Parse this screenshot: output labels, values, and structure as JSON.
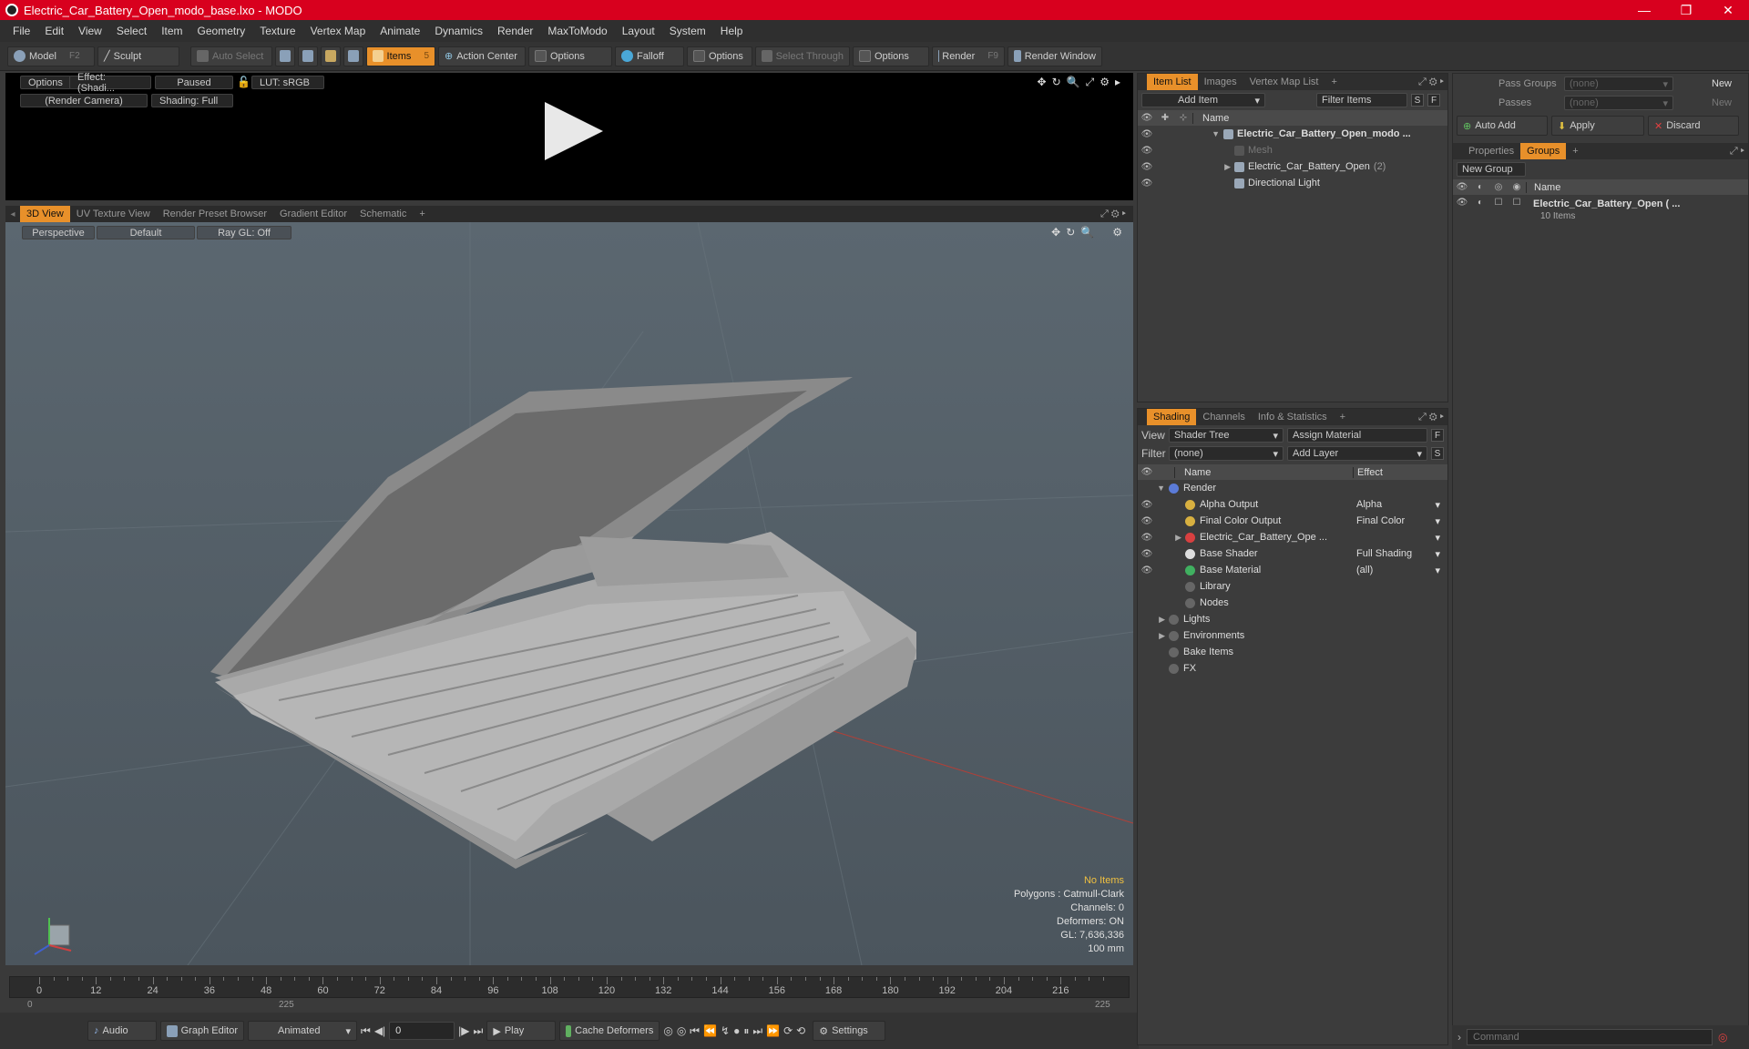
{
  "window": {
    "title": "Electric_Car_Battery_Open_modo_base.lxo - MODO",
    "min": "—",
    "max": "❐",
    "close": "✕"
  },
  "menu": [
    "File",
    "Edit",
    "View",
    "Select",
    "Item",
    "Geometry",
    "Texture",
    "Vertex Map",
    "Animate",
    "Dynamics",
    "Render",
    "MaxToModo",
    "Layout",
    "System",
    "Help"
  ],
  "toolbar": {
    "model": "Model",
    "model_key": "F2",
    "sculpt": "Sculpt",
    "auto_select": "Auto Select",
    "items": "Items",
    "items_key": "5",
    "action_center": "Action Center",
    "options1": "Options",
    "falloff": "Falloff",
    "options2": "Options",
    "select_through": "Select Through",
    "options3": "Options",
    "render": "Render",
    "render_key": "F9",
    "render_window": "Render Window"
  },
  "preview": {
    "options": "Options",
    "effect": "Effect: (Shadi...",
    "paused": "Paused",
    "lut": "LUT: sRGB",
    "camera": "(Render Camera)",
    "shading": "Shading: Full"
  },
  "viewtabs": [
    "3D View",
    "UV Texture View",
    "Render Preset Browser",
    "Gradient Editor",
    "Schematic",
    "+"
  ],
  "viewport": {
    "perspective": "Perspective",
    "default": "Default",
    "raygl": "Ray GL: Off"
  },
  "hud": {
    "items": "No Items",
    "polygons": "Polygons : Catmull-Clark",
    "channels": "Channels: 0",
    "deformers": "Deformers: ON",
    "gl": "GL: 7,636,336",
    "scale": "100 mm"
  },
  "timeline": {
    "labels": [
      "0",
      "12",
      "24",
      "36",
      "48",
      "60",
      "72",
      "84",
      "96",
      "108",
      "120",
      "132",
      "144",
      "156",
      "168",
      "180",
      "192",
      "204",
      "216"
    ],
    "start": "0",
    "end_a": "225",
    "end_b": "225"
  },
  "bottom": {
    "audio": "Audio",
    "graph_editor": "Graph Editor",
    "animated": "Animated",
    "frame": "0",
    "play": "Play",
    "cache": "Cache Deformers",
    "settings": "Settings"
  },
  "itemlist": {
    "tabs": [
      "Item List",
      "Images",
      "Vertex Map List",
      "+"
    ],
    "add_item": "Add Item",
    "filter": "Filter Items",
    "s": "S",
    "f": "F",
    "col_name": "Name",
    "rows": [
      {
        "label": "Electric_Car_Battery_Open_modo ...",
        "bold": true,
        "indent": 0,
        "arrow": "▼"
      },
      {
        "label": "Mesh",
        "dim": true,
        "indent": 1,
        "arrow": ""
      },
      {
        "label": "Electric_Car_Battery_Open",
        "count": "(2)",
        "indent": 1,
        "arrow": "▶"
      },
      {
        "label": "Directional Light",
        "indent": 1,
        "arrow": ""
      }
    ]
  },
  "shading": {
    "tabs": [
      "Shading",
      "Channels",
      "Info & Statistics",
      "+"
    ],
    "view_label": "View",
    "view_value": "Shader Tree",
    "assign": "Assign Material",
    "f": "F",
    "filter_label": "Filter",
    "filter_value": "(none)",
    "add_layer": "Add Layer",
    "s": "S",
    "col_name": "Name",
    "col_effect": "Effect",
    "rows": [
      {
        "label": "Render",
        "effect": "",
        "indent": 0,
        "arrow": "▼",
        "eye": false,
        "color": "#5b7bd8"
      },
      {
        "label": "Alpha Output",
        "effect": "Alpha",
        "indent": 1,
        "eye": true,
        "color": "#d8b040"
      },
      {
        "label": "Final Color Output",
        "effect": "Final Color",
        "indent": 1,
        "eye": true,
        "color": "#d8b040"
      },
      {
        "label": "Electric_Car_Battery_Ope ...",
        "effect": "",
        "indent": 1,
        "arrow": "▶",
        "eye": true,
        "color": "#d84040"
      },
      {
        "label": "Base Shader",
        "effect": "Full Shading",
        "indent": 1,
        "eye": true,
        "color": "#dddddd"
      },
      {
        "label": "Base Material",
        "effect": "(all)",
        "indent": 1,
        "eye": true,
        "color": "#40b060"
      },
      {
        "label": "Library",
        "indent": 1,
        "arrow": "",
        "eye": false,
        "color": ""
      },
      {
        "label": "Nodes",
        "indent": 1,
        "eye": false,
        "color": ""
      },
      {
        "label": "Lights",
        "indent": 0,
        "arrow": "▶",
        "eye": false,
        "color": ""
      },
      {
        "label": "Environments",
        "indent": 0,
        "arrow": "▶",
        "eye": false,
        "color": ""
      },
      {
        "label": "Bake Items",
        "indent": 0,
        "eye": false,
        "color": ""
      },
      {
        "label": "FX",
        "indent": 0,
        "eye": false,
        "color": ""
      }
    ]
  },
  "groups": {
    "pass_groups": "Pass Groups",
    "pass_groups_value": "(none)",
    "new1": "New",
    "passes": "Passes",
    "passes_value": "(none)",
    "new2": "New",
    "auto_add": "Auto Add",
    "apply": "Apply",
    "discard": "Discard",
    "tabs": [
      "Properties",
      "Groups",
      "+"
    ],
    "new_group": "New Group",
    "col_name": "Name",
    "group_name": "Electric_Car_Battery_Open ( ...",
    "group_items": "10 Items"
  },
  "command": {
    "placeholder": "Command"
  },
  "colors": {
    "accent": "#e8902a",
    "title": "#d8001e"
  }
}
